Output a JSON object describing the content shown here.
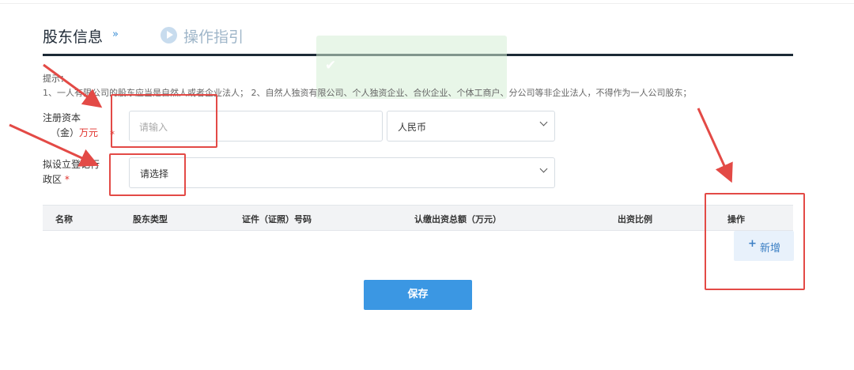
{
  "header": {
    "title": "股东信息",
    "chevron": "»",
    "guide_label": "操作指引"
  },
  "toast": {
    "check": "✔",
    "message": ""
  },
  "tips": {
    "label": "提示：",
    "text": "1、一人有限公司的股东应当是自然人或者企业法人；  2、自然人独资有限公司、个人独资企业、合伙企业、个体工商户、分公司等非企业法人，不得作为一人公司股东；"
  },
  "form": {
    "capital": {
      "label_line1": "注册资本",
      "label_line2": "（金）",
      "unit": "万元",
      "required_mark": "*",
      "placeholder": "请输入",
      "currency": "人民币"
    },
    "district": {
      "label_line1": "拟设立登记行",
      "label_line2": "政区",
      "required_mark": "*",
      "value": "请选择"
    }
  },
  "table": {
    "columns": [
      "名称",
      "股东类型",
      "证件（证照）号码",
      "认缴出资总额（万元）",
      "出资比例",
      "操作"
    ]
  },
  "actions": {
    "add_plus": "+",
    "add_label": "新增",
    "save_label": "保存"
  },
  "colors": {
    "accent": "#3b97e3",
    "required": "#e0312b",
    "annotation": "#e34a46"
  }
}
